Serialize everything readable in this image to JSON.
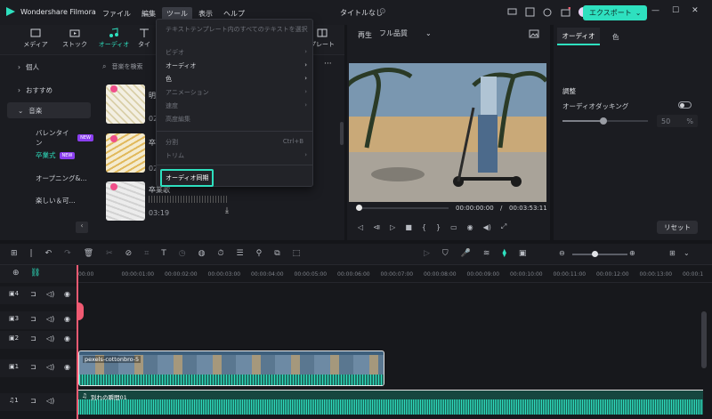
{
  "app": {
    "title": "Wondershare Filmora",
    "document_title": "タイトルなし",
    "export_label": "エクスポート"
  },
  "menu": [
    "ファイル",
    "編集",
    "ツール",
    "表示",
    "ヘルプ"
  ],
  "media_tabs": [
    "メディア",
    "ストック",
    "オーディオ",
    "タイ",
    "プレート"
  ],
  "sidebar": {
    "items": [
      {
        "label": "個人"
      },
      {
        "label": "おすすめ"
      },
      {
        "label": "音楽"
      }
    ],
    "sub": [
      {
        "label": "バレンタイン",
        "badge": "NEW"
      },
      {
        "label": "卒業式",
        "badge": "NEW"
      },
      {
        "label": "オープニング&..."
      },
      {
        "label": "楽しい＆可..."
      }
    ]
  },
  "search": {
    "placeholder": "音楽を検索"
  },
  "media_items": [
    {
      "title": "明",
      "duration": "02"
    },
    {
      "title": "卒",
      "duration": "02"
    },
    {
      "title": "卒業歌",
      "duration": "03:19"
    }
  ],
  "dropdown": {
    "header": "テキストテンプレート内のすべてのテキストを選択",
    "items": [
      {
        "label": "ビデオ",
        "arrow": "›"
      },
      {
        "label": "オーディオ",
        "arrow": "›"
      },
      {
        "label": "色",
        "arrow": "›"
      },
      {
        "label": "アニメーション",
        "arrow": "›"
      },
      {
        "label": "速度",
        "arrow": "›"
      },
      {
        "label": "高度編集",
        "arrow": ""
      }
    ],
    "split": "分割",
    "split_shortcut": "Ctrl+B",
    "trim": "トリム",
    "sync": "オーディオ同期"
  },
  "preview": {
    "play_label": "再生",
    "quality": "フル品質",
    "current_time": "00:00:00:00",
    "separator": "/",
    "total_time": "00:03:53:11"
  },
  "right_panel": {
    "tabs": [
      "オーディオ",
      "色"
    ],
    "section": "調整",
    "ducking_label": "オーディオダッキング",
    "ducking_value": "50",
    "unit": "%",
    "ducking_fraction": 0.48,
    "reset_label": "リセット"
  },
  "timeline": {
    "ticks": [
      "00:00",
      "00:00:01:00",
      "00:00:02:00",
      "00:00:03:00",
      "00:00:04:00",
      "00:00:05:00",
      "00:00:06:00",
      "00:00:07:00",
      "00:00:08:00",
      "00:00:09:00",
      "00:00:10:00",
      "00:00:11:00",
      "00:00:12:00",
      "00:00:13:00",
      "00:00:1"
    ],
    "tracks": [
      {
        "label": "4"
      },
      {
        "label": "3"
      },
      {
        "label": "2"
      },
      {
        "label": "1"
      },
      {
        "label": "1"
      }
    ],
    "video_clip": "pexels-cottonbro-5",
    "audio_clip": "別れの瞬間01",
    "zoom_fraction": 0.35
  },
  "colors": {
    "accent": "#2ee0bf",
    "new_badge": "#8b3ff0",
    "highlight": "#2ee0bf"
  }
}
